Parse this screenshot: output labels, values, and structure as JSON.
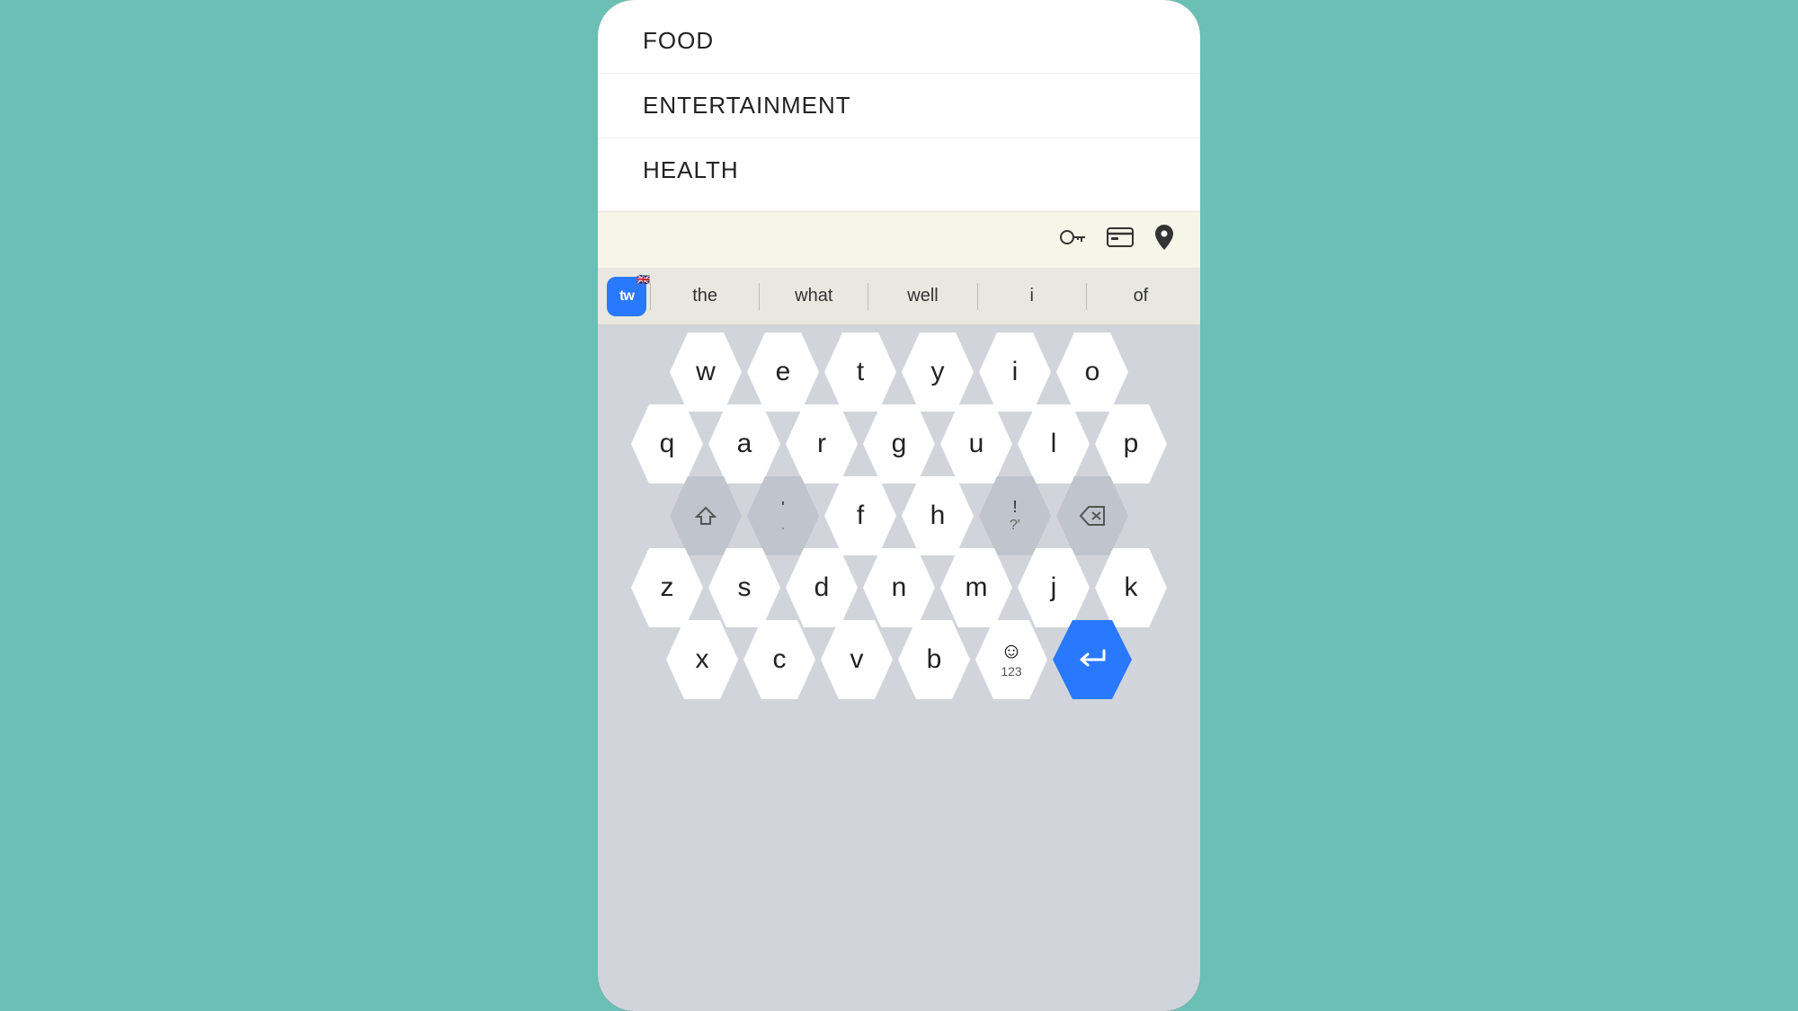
{
  "background": "#6BBFB5",
  "menu": {
    "items": [
      {
        "label": "FOOD"
      },
      {
        "label": "ENTERTAINMENT"
      },
      {
        "label": "HEALTH"
      }
    ]
  },
  "toolbar": {
    "icons": [
      {
        "name": "key-icon",
        "symbol": "🔑"
      },
      {
        "name": "card-icon",
        "symbol": "💳"
      },
      {
        "name": "location-icon",
        "symbol": "📍"
      }
    ]
  },
  "suggestions": {
    "logo_text": "tw",
    "items": [
      {
        "label": "the"
      },
      {
        "label": "what"
      },
      {
        "label": "well"
      },
      {
        "label": "i"
      },
      {
        "label": "of"
      }
    ]
  },
  "keyboard": {
    "rows": [
      [
        "w",
        "e",
        "t",
        "y",
        "i",
        "o"
      ],
      [
        "q",
        "a",
        "r",
        "g",
        "u",
        "l",
        "p"
      ],
      [
        "⇧",
        "',.",
        "f",
        "h",
        "!?'",
        "⌫"
      ],
      [
        "z",
        "s",
        "d",
        "n",
        "m",
        "j",
        "k"
      ],
      [
        "x",
        "c",
        "v",
        "b",
        "😊\n123",
        "↩"
      ]
    ]
  }
}
